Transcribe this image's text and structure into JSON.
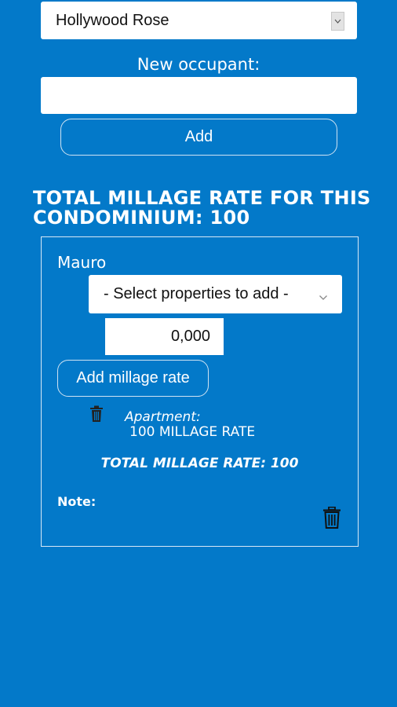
{
  "condominium_select": {
    "selected": "Hollywood Rose"
  },
  "new_occupant": {
    "label": "New occupant:",
    "value": "",
    "add_label": "Add"
  },
  "total_title": "TOTAL MILLAGE RATE FOR THIS CONDOMINIUM: 100",
  "occupant_card": {
    "name": "Mauro",
    "property_select_placeholder": "- Select properties to add -",
    "millage_value": "0,000",
    "add_millage_label": "Add millage rate",
    "properties": [
      {
        "type": "Apartment:",
        "rate_text": "100 MILLAGE RATE"
      }
    ],
    "total_text": "TOTAL MILLAGE RATE: 100",
    "note_label": "Note:"
  },
  "icons": {
    "delete_property": "trash-icon",
    "delete_occupant": "trash-icon",
    "dropdown": "chevron-down-icon"
  },
  "colors": {
    "background": "#0379c9",
    "text": "#ffffff"
  }
}
